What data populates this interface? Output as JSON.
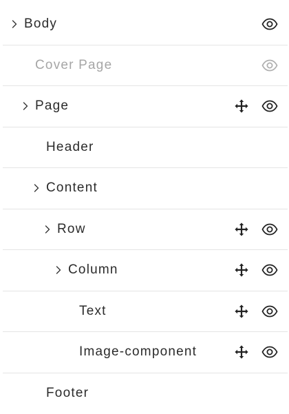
{
  "tree": {
    "items": [
      {
        "label": "Body",
        "depth": 0,
        "expandable": true,
        "draggable": false,
        "visible_toggle": "on",
        "muted": false
      },
      {
        "label": "Cover Page",
        "depth": 1,
        "expandable": false,
        "draggable": false,
        "visible_toggle": "muted",
        "muted": true
      },
      {
        "label": "Page",
        "depth": 1,
        "expandable": true,
        "draggable": true,
        "visible_toggle": "on",
        "muted": false
      },
      {
        "label": "Header",
        "depth": 2,
        "expandable": false,
        "draggable": false,
        "visible_toggle": "none",
        "muted": false
      },
      {
        "label": "Content",
        "depth": 2,
        "expandable": true,
        "draggable": false,
        "visible_toggle": "none",
        "muted": false
      },
      {
        "label": "Row",
        "depth": 3,
        "expandable": true,
        "draggable": true,
        "visible_toggle": "on",
        "muted": false
      },
      {
        "label": "Column",
        "depth": 4,
        "expandable": true,
        "draggable": true,
        "visible_toggle": "on",
        "muted": false
      },
      {
        "label": "Text",
        "depth": 5,
        "expandable": false,
        "draggable": true,
        "visible_toggle": "on",
        "muted": false
      },
      {
        "label": "Image-component",
        "depth": 5,
        "expandable": false,
        "draggable": true,
        "visible_toggle": "on",
        "muted": false
      },
      {
        "label": "Footer",
        "depth": 2,
        "expandable": false,
        "draggable": false,
        "visible_toggle": "none",
        "muted": false
      }
    ]
  },
  "icons": {
    "expand": "chevron-right-icon",
    "move": "move-arrows-icon",
    "visibility": "eye-icon"
  },
  "colors": {
    "text": "#2b2b2b",
    "muted_text": "#a6a6a6",
    "icon": "#222222",
    "muted_icon": "#b0b0b0",
    "divider": "#e4e4e4"
  }
}
